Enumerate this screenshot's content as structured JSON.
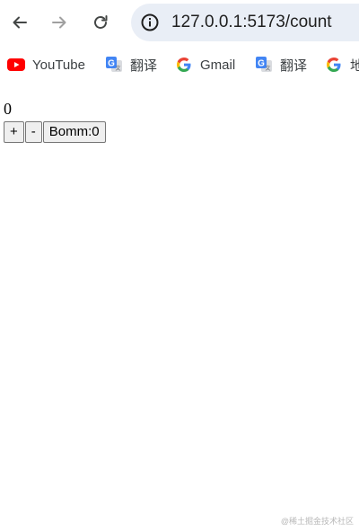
{
  "browser": {
    "url": "127.0.0.1:5173/count"
  },
  "bookmarks": [
    {
      "label": "YouTube",
      "icon": "youtube-icon"
    },
    {
      "label": "翻译",
      "icon": "google-translate-icon"
    },
    {
      "label": "Gmail",
      "icon": "google-g-icon"
    },
    {
      "label": "翻译",
      "icon": "google-translate-icon"
    },
    {
      "label": "地",
      "icon": "google-g-icon"
    }
  ],
  "page": {
    "count": "0",
    "increment_label": "+",
    "decrement_label": "-",
    "bomb_label": "Bomm:0"
  },
  "watermark": "@稀土掘金技术社区",
  "colors": {
    "youtube_red": "#ff0000",
    "omnibox_bg": "#e9eef6",
    "button_bg": "#efefef"
  }
}
